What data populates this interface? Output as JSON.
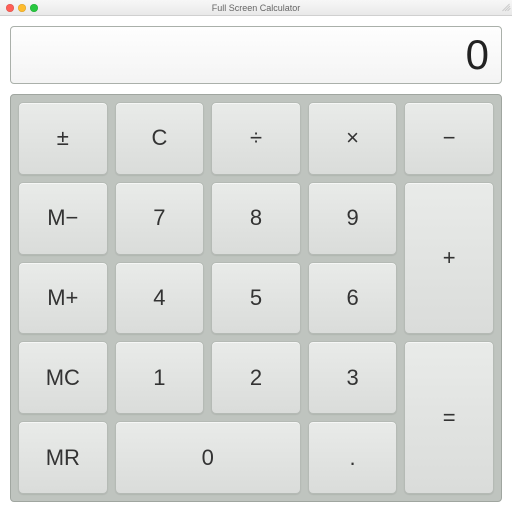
{
  "window": {
    "title": "Full Screen Calculator"
  },
  "display": {
    "value": "0"
  },
  "keys": {
    "plus_minus": "±",
    "clear": "C",
    "divide": "÷",
    "multiply": "×",
    "minus": "−",
    "mem_minus": "M−",
    "seven": "7",
    "eight": "8",
    "nine": "9",
    "plus": "+",
    "mem_plus": "M+",
    "four": "4",
    "five": "5",
    "six": "6",
    "mem_clear": "MC",
    "one": "1",
    "two": "2",
    "three": "3",
    "equals": "=",
    "mem_recall": "MR",
    "zero": "0",
    "decimal": "."
  }
}
